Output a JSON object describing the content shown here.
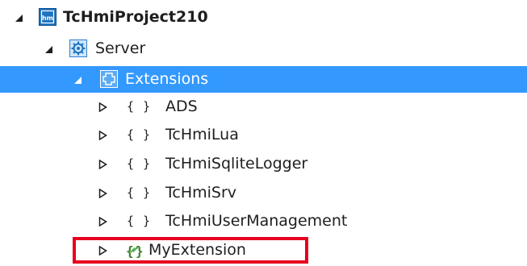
{
  "tree": {
    "root": {
      "label": "TcHmiProject210",
      "icon": "hmi-project-icon",
      "expanded": true
    },
    "server": {
      "label": "Server",
      "icon": "server-gear-icon",
      "expanded": true
    },
    "extensions": {
      "label": "Extensions",
      "icon": "extensions-folder-icon",
      "expanded": true,
      "selected": true
    },
    "children": [
      {
        "label": "ADS",
        "icon": "{ }",
        "expanded": false
      },
      {
        "label": "TcHmiLua",
        "icon": "{ }",
        "expanded": false
      },
      {
        "label": "TcHmiSqliteLogger",
        "icon": "{ }",
        "expanded": false
      },
      {
        "label": "TcHmiSrv",
        "icon": "{ }",
        "expanded": false
      },
      {
        "label": "TcHmiUserManagement",
        "icon": "{ }",
        "expanded": false
      },
      {
        "label": "MyExtension",
        "icon": "custom-extension-icon",
        "expanded": false,
        "highlighted": true
      }
    ]
  },
  "colors": {
    "selection": "#3399ff",
    "highlight_border": "#e6001e",
    "text": "#1e1e1e"
  }
}
